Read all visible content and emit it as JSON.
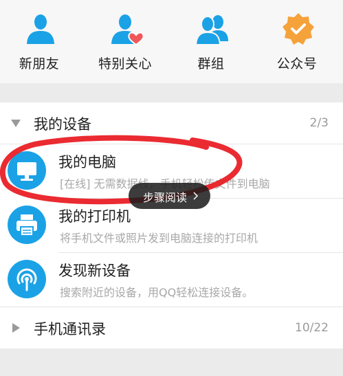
{
  "shortcuts": [
    {
      "label": "新朋友",
      "icon": "new-friend-icon"
    },
    {
      "label": "特别关心",
      "icon": "special-care-icon"
    },
    {
      "label": "群组",
      "icon": "group-icon"
    },
    {
      "label": "公众号",
      "icon": "official-account-icon"
    }
  ],
  "device_group": {
    "title": "我的设备",
    "count": "2/3",
    "items": [
      {
        "name": "我的电脑",
        "desc": "[在线] 无需数据线，手机轻松传文件到电脑",
        "icon": "computer-icon"
      },
      {
        "name": "我的打印机",
        "desc": "将手机文件或照片发到电脑连接的打印机",
        "icon": "printer-icon"
      },
      {
        "name": "发现新设备",
        "desc": "搜索附近的设备，用QQ轻松连接设备。",
        "icon": "discover-device-icon"
      }
    ]
  },
  "contacts_group": {
    "title": "手机通讯录",
    "count": "10/22"
  },
  "toast": {
    "label": "步骤阅读"
  },
  "colors": {
    "accent": "#1ba2e6",
    "highlight": "#e8191f",
    "badge": "#f5a23a",
    "heart": "#f0575a"
  }
}
